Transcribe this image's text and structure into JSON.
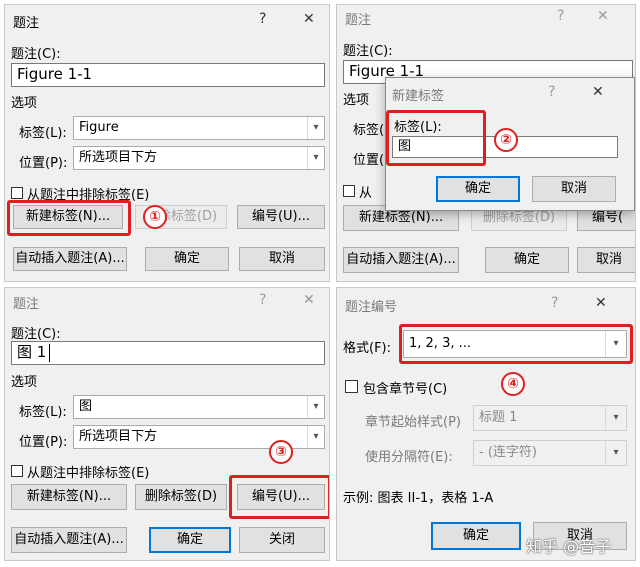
{
  "panel1": {
    "title": "题注",
    "help": "?",
    "close": "✕",
    "caption_label": "题注(C):",
    "caption_value": "Figure 1-1",
    "options": "选项",
    "label_label": "标签(L):",
    "label_value": "Figure",
    "position_label": "位置(P):",
    "position_value": "所选项目下方",
    "exclude": "从题注中排除标签(E)",
    "new_label": "新建标签(N)...",
    "delete_label": "删除标签(D)",
    "numbering": "编号(U)...",
    "autocaption": "自动插入题注(A)...",
    "ok": "确定",
    "cancel": "取消",
    "step": "①"
  },
  "panel2": {
    "title": "题注",
    "help": "?",
    "close": "✕",
    "caption_label": "题注(C):",
    "caption_value": "Figure 1-1",
    "options": "选项",
    "label_label": "标签(L",
    "position_label": "位置(P",
    "exclude": "从",
    "new_label": "新建标签(N)...",
    "delete_label": "删除标签(D)",
    "numbering": "编号(",
    "autocaption": "自动插入题注(A)...",
    "ok": "确定",
    "cancel": "取消",
    "popup": {
      "title": "新建标签",
      "help": "?",
      "close": "✕",
      "label_label": "标签(L):",
      "label_value": "图",
      "ok": "确定",
      "cancel": "取消"
    },
    "step": "②"
  },
  "panel3": {
    "title": "题注",
    "help": "?",
    "close": "✕",
    "caption_label": "题注(C):",
    "caption_value": "图 1",
    "options": "选项",
    "label_label": "标签(L):",
    "label_value": "图",
    "position_label": "位置(P):",
    "position_value": "所选项目下方",
    "exclude": "从题注中排除标签(E)",
    "new_label": "新建标签(N)...",
    "delete_label": "删除标签(D)",
    "numbering": "编号(U)...",
    "autocaption": "自动插入题注(A)...",
    "ok": "确定",
    "close_btn": "关闭",
    "step": "③"
  },
  "panel4": {
    "title": "题注编号",
    "help": "?",
    "close": "✕",
    "format_label": "格式(F):",
    "format_value": "1, 2, 3, ...",
    "include_chapter": "包含章节号(C)",
    "chapter_style_label": "章节起始样式(P)",
    "chapter_style_value": "标题 1",
    "separator_label": "使用分隔符(E):",
    "separator_value": "-    (连字符)",
    "example": "示例:  图表 II-1，表格 1-A",
    "ok": "确定",
    "cancel": "取消",
    "step": "④"
  },
  "watermark": "知乎 @音子",
  "colors": {
    "highlight": "#e02020",
    "dialog_bg": "#f0f0f0",
    "accent": "#0078d7"
  },
  "icons": {
    "dropdown": "chevron-down-icon",
    "close": "close-icon",
    "help": "help-icon"
  }
}
